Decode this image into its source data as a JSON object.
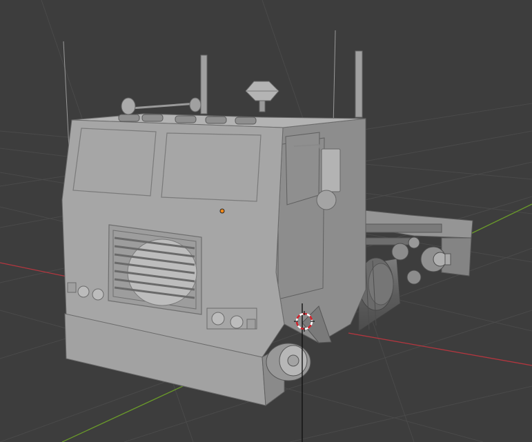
{
  "viewport": {
    "mode": "3d-viewport",
    "shading": "solid",
    "colors": {
      "background": "#3d3d3d",
      "grid": "#4a4a4a",
      "x_axis": "#b4363f",
      "y_axis": "#6a9a2a",
      "model_light": "#a9a9a9",
      "model_mid": "#8e8e8e",
      "model_dark": "#6a6a6a",
      "origin_dot": "#f28a1b"
    },
    "objects": [
      "truck-cab-model",
      "3d-cursor",
      "object-origin"
    ]
  }
}
